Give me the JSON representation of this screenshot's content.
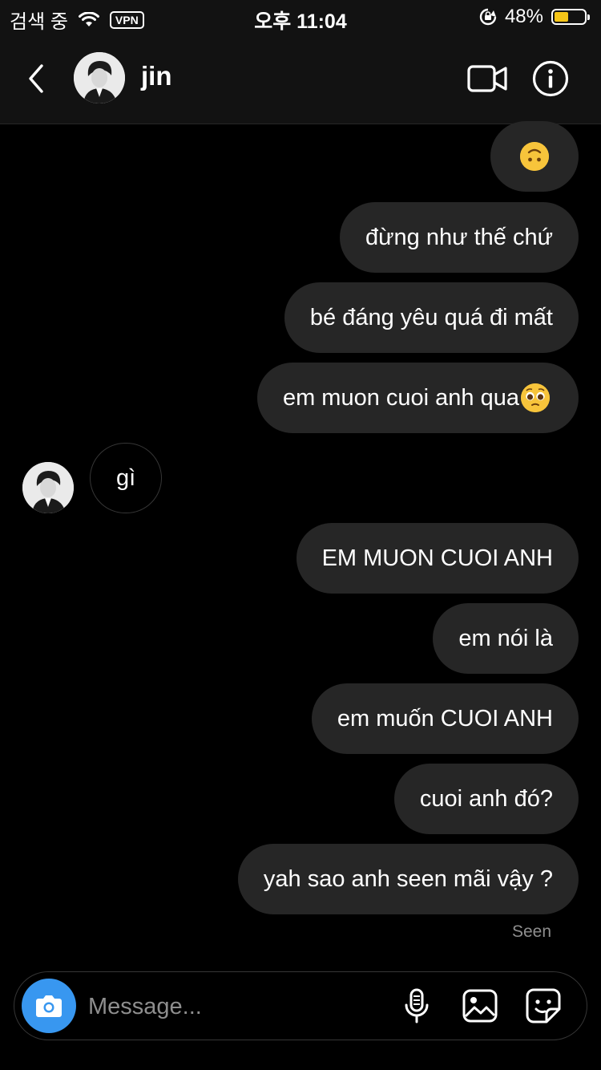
{
  "status_bar": {
    "carrier": "검색 중",
    "vpn": "VPN",
    "time": "오후 11:04",
    "battery": "48%",
    "battery_level": 0.48
  },
  "header": {
    "title": "jin",
    "icons": [
      "back-arrow",
      "avatar",
      "video-camera",
      "info"
    ]
  },
  "messages": [
    {
      "direction": "out",
      "emoji": "upside-down-face"
    },
    {
      "direction": "out",
      "text": "đừng như thế chứ"
    },
    {
      "direction": "out",
      "text": "bé đáng yêu quá đi mất"
    },
    {
      "direction": "out",
      "text": "em muon cuoi anh qua",
      "emoji": "pleading-face"
    },
    {
      "direction": "in",
      "text": "gì"
    },
    {
      "direction": "out",
      "text": "EM MUON CUOI ANH"
    },
    {
      "direction": "out",
      "text": "em nói là"
    },
    {
      "direction": "out",
      "text": "em muốn CUOI ANH"
    },
    {
      "direction": "out",
      "text": "cuoi anh đó?"
    },
    {
      "direction": "out",
      "text": "yah sao anh seen mãi vậy ?"
    }
  ],
  "seen_label": "Seen",
  "composer": {
    "placeholder": "Message...",
    "icons": [
      "camera",
      "microphone",
      "gallery",
      "sticker"
    ]
  },
  "colors": {
    "background": "#000000",
    "bubble_out": "#262626",
    "camera_button": "#3897f0",
    "muted_text": "#8e8e8e"
  }
}
